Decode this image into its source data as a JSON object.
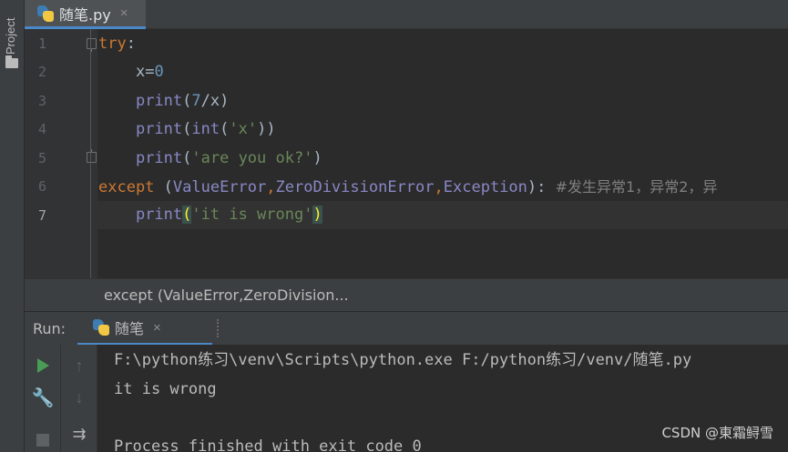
{
  "side_panel": {
    "project_label": "Project"
  },
  "editor_tab": {
    "file_name": "随笔.py",
    "close": "×"
  },
  "editor": {
    "line_numbers": [
      "1",
      "2",
      "3",
      "4",
      "5",
      "6",
      "7"
    ],
    "lines": {
      "l1": {
        "kw": "try",
        "punct": ":"
      },
      "l2": {
        "indent": "    ",
        "var": "x=",
        "num": "0"
      },
      "l3": {
        "indent": "    ",
        "fn": "print",
        "open": "(",
        "num": "7",
        "rest": "/x)"
      },
      "l4": {
        "indent": "    ",
        "fn": "print",
        "open": "(",
        "fn2": "int",
        "open2": "(",
        "str": "'x'",
        "close": "))"
      },
      "l5": {
        "indent": "    ",
        "fn": "print",
        "open": "(",
        "str": "'are you ok?'",
        "close": ")"
      },
      "l6": {
        "kw": "except",
        "sp": " (",
        "c1": "ValueError",
        "comma1": ",",
        "c2": "ZeroDivisionError",
        "comma2": ",",
        "c3": "Exception",
        "close": "): ",
        "comment": "#发生异常1，异常2，异"
      },
      "l7": {
        "indent": "    ",
        "fn": "print",
        "open": "(",
        "str": "'it is wrong'",
        "close": ")"
      }
    }
  },
  "breadcrumb": {
    "text": "except (ValueError,ZeroDivision..."
  },
  "run_panel": {
    "title": "Run:",
    "tab_label": "随笔",
    "close": "×",
    "console": [
      "F:\\python练习\\venv\\Scripts\\python.exe F:/python练习/venv/随笔.py",
      "it is wrong",
      "",
      "Process finished with exit code 0"
    ]
  },
  "watermark": "CSDN @東霜鲟雪",
  "colors": {
    "keyword": "#cc7832",
    "builtin": "#8888c6",
    "number": "#6897bb",
    "string": "#6a8759",
    "comment": "#808080",
    "accent": "#4a88c7",
    "run_green": "#499c54"
  },
  "icons": [
    "folder-icon",
    "python-icon",
    "close-icon",
    "fold-marker-icon",
    "play-icon",
    "wrench-icon",
    "stop-icon",
    "up-arrow-icon",
    "down-arrow-icon",
    "soft-wrap-icon"
  ]
}
